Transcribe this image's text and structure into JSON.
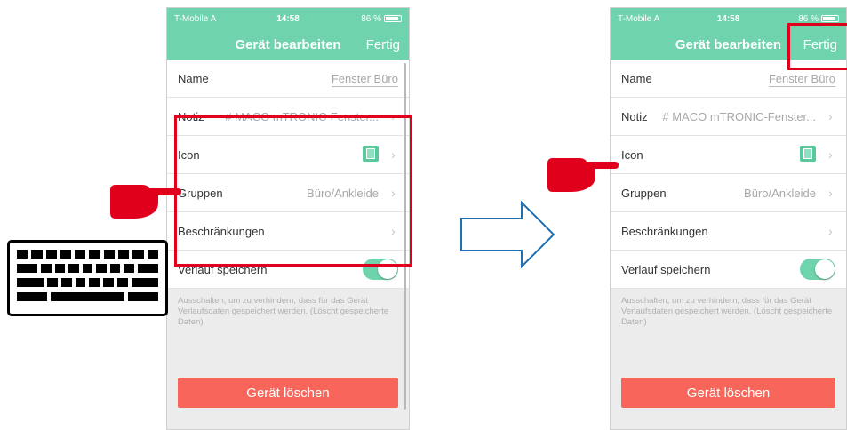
{
  "left_screen": {
    "status": {
      "carrier": "T-Mobile A",
      "time": "14:58",
      "battery": "86 %"
    },
    "nav": {
      "title": "Gerät bearbeiten",
      "done": "Fertig"
    },
    "rows": {
      "name_label": "Name",
      "name_value": "Fenster Büro",
      "note_label": "Notiz",
      "note_value": "# MACO mTRONIC-Fenster...",
      "icon_label": "Icon",
      "groups_label": "Gruppen",
      "groups_value": "Büro/Ankleide",
      "restrictions_label": "Beschränkungen",
      "history_label": "Verlauf speichern"
    },
    "hint": "Ausschalten, um zu verhindern, dass für das Gerät Verlaufsdaten gespeichert werden. (Löscht gespeicherte Daten)",
    "delete_button": "Gerät löschen"
  },
  "right_screen": {
    "status": {
      "carrier": "T-Mobile A",
      "time": "14:58",
      "battery": "86 %"
    },
    "nav": {
      "title": "Gerät bearbeiten",
      "done": "Fertig"
    },
    "rows": {
      "name_label": "Name",
      "name_value": "Fenster Büro",
      "note_label": "Notiz",
      "note_value": "# MACO mTRONIC-Fenster...",
      "icon_label": "Icon",
      "groups_label": "Gruppen",
      "groups_value": "Büro/Ankleide",
      "restrictions_label": "Beschränkungen",
      "history_label": "Verlauf speichern"
    },
    "hint": "Ausschalten, um zu verhindern, dass für das Gerät Verlaufsdaten gespeichert werden. (Löscht gespeicherte Daten)",
    "delete_button": "Gerät löschen"
  },
  "colors": {
    "accent": "#6fd3ad",
    "delete": "#f8665b",
    "annotation": "#e0001b",
    "arrow": "#1f6fb5"
  },
  "icons": {
    "pointer": "pointing-hand-icon",
    "keyboard": "keyboard-icon",
    "arrow": "right-arrow-icon",
    "chevron": "chevron-right-icon"
  }
}
